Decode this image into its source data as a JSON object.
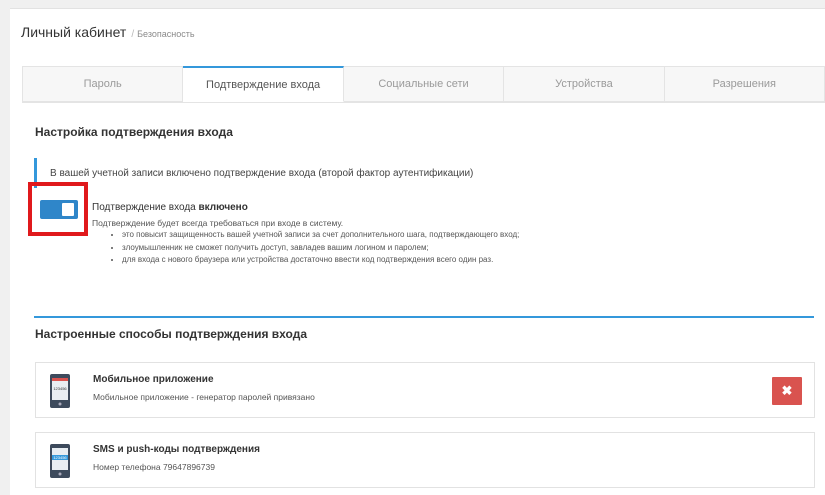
{
  "breadcrumb": {
    "root": "Личный кабинет",
    "separator": "/",
    "current": "Безопасность"
  },
  "tabs": [
    {
      "label": "Пароль",
      "active": false
    },
    {
      "label": "Подтверждение входа",
      "active": true
    },
    {
      "label": "Социальные сети",
      "active": false
    },
    {
      "label": "Устройства",
      "active": false
    },
    {
      "label": "Разрешения",
      "active": false
    }
  ],
  "settings": {
    "title": "Настройка подтверждения входа",
    "info": "В вашей учетной записи включено подтверждение входа (второй фактор аутентификации)",
    "toggle_state": "on",
    "status_prefix": "Подтверждение входа",
    "status_value": "включено",
    "description": "Подтверждение будет всегда требоваться при входе в систему.",
    "bullets": [
      "это повысит защищенность вашей учетной записи за счет дополнительного шага, подтверждающего вход;",
      "злоумышленник не сможет получить доступ, завладев вашим логином и паролем;",
      "для входа с нового браузера или устройства достаточно ввести код подтверждения всего один раз."
    ]
  },
  "methods": {
    "title": "Настроенные способы подтверждения входа",
    "items": [
      {
        "name": "Мобильное приложение",
        "detail": "Мобильное приложение - генератор паролей привязано",
        "icon": "mobile-app-icon",
        "code": "123456"
      },
      {
        "name": "SMS и push-коды подтверждения",
        "detail": "Номер телефона 79647896739",
        "icon": "sms-phone-icon",
        "code": "123456"
      }
    ],
    "delete_glyph": "✖"
  },
  "colors": {
    "accent": "#3498db",
    "toggle": "#2f86c9",
    "highlight": "#e0191c",
    "danger": "#d9534f"
  }
}
